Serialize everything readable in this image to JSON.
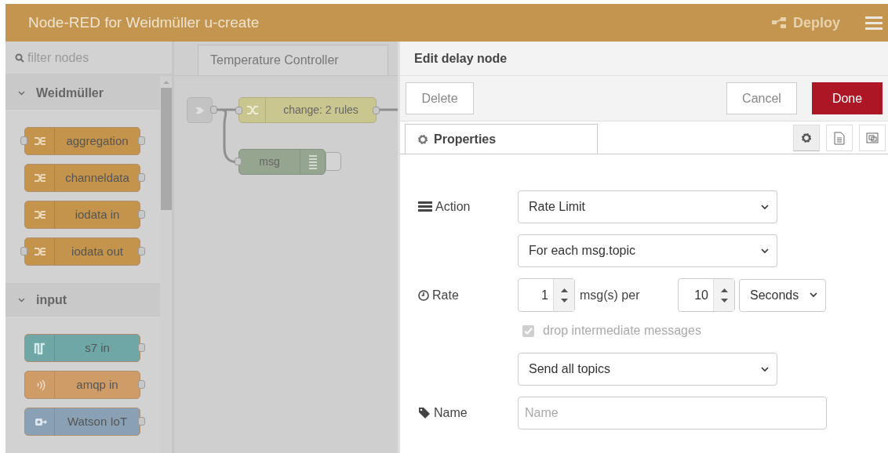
{
  "header": {
    "title": "Node-RED for Weidmüller u-create",
    "deploy": {
      "label": "Deploy",
      "disabled": true
    }
  },
  "palette": {
    "filter_placeholder": "filter nodes",
    "categories": [
      {
        "label": "Weidmüller",
        "expanded": true,
        "nodes": [
          {
            "label": "aggregation",
            "kind": "flow",
            "color": "#c4944c",
            "input": true
          },
          {
            "label": "channeldata",
            "kind": "flow",
            "color": "#c4944c",
            "input": false
          },
          {
            "label": "iodata in",
            "kind": "flow",
            "color": "#c4944c",
            "input": false
          },
          {
            "label": "iodata out",
            "kind": "flow",
            "color": "#c4944c",
            "input": true
          }
        ]
      },
      {
        "label": "input",
        "expanded": true,
        "nodes": [
          {
            "label": "s7 in",
            "kind": "wave",
            "color": "#6fa6a6",
            "input": false
          },
          {
            "label": "amqp in",
            "kind": "radio",
            "color": "#cf9b66",
            "input": false
          },
          {
            "label": "Watson IoT",
            "kind": "chip",
            "color": "#8aa1b5",
            "input": false
          }
        ]
      }
    ]
  },
  "workspace": {
    "tabs": [
      {
        "label": "Temperature Controller",
        "selected": true
      }
    ],
    "nodes": [
      {
        "label": "change: 2 rules",
        "kind": "change"
      },
      {
        "label": "msg",
        "kind": "debug"
      }
    ]
  },
  "tray": {
    "title": "Edit delay node",
    "buttons": [
      {
        "label": "Delete",
        "kind": "plain"
      },
      {
        "label": "Cancel",
        "kind": "plain"
      },
      {
        "label": "Done",
        "kind": "primary"
      }
    ],
    "tabs": [
      {
        "label": "Properties",
        "selected": true
      }
    ],
    "form": [
      {
        "kind": "select",
        "label": "Action",
        "value": "Rate Limit"
      },
      {
        "kind": "select",
        "value": "For each msg.topic"
      },
      {
        "kind": "rate",
        "label": "Rate",
        "count": "1",
        "middle": "msg(s) per",
        "period": "10",
        "unit": "Seconds"
      },
      {
        "kind": "checkbox",
        "label": "drop intermediate messages",
        "checked": true,
        "disabled": true
      },
      {
        "kind": "select",
        "value": "Send all topics"
      },
      {
        "kind": "input",
        "label": "Name",
        "placeholder": "Name"
      }
    ]
  }
}
